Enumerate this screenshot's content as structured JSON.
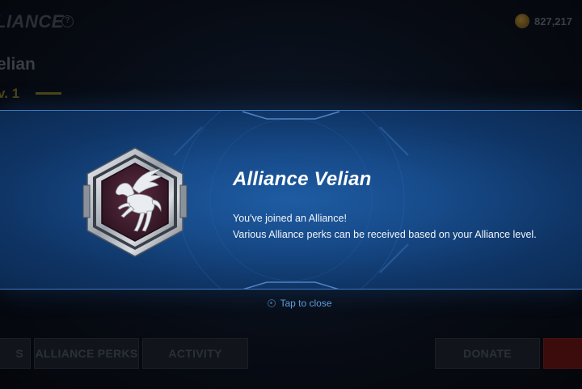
{
  "background_screen": {
    "title": "LIANCE",
    "help_icon": "?",
    "currency": {
      "icon": "gold-coin-icon",
      "amount": "827,217"
    },
    "alliance_name": "elian",
    "level": "v. 1",
    "tabs": [
      {
        "label": "S"
      },
      {
        "label": "ALLIANCE PERKS"
      },
      {
        "label": "ACTIVITY"
      },
      {
        "label": "DONATE"
      }
    ]
  },
  "popup": {
    "emblem_icon": "pegasus-shield-icon",
    "title": "Alliance Velian",
    "message_line1": "You've joined an Alliance!",
    "message_line2": "Various Alliance perks can be received based on your Alliance level.",
    "close_hint": "Tap to close"
  },
  "colors": {
    "banner_blue": "#174b8a",
    "emblem_maroon": "#4a2434",
    "emblem_silver": "#c9ced6",
    "hint_blue": "#5f9ddd"
  }
}
